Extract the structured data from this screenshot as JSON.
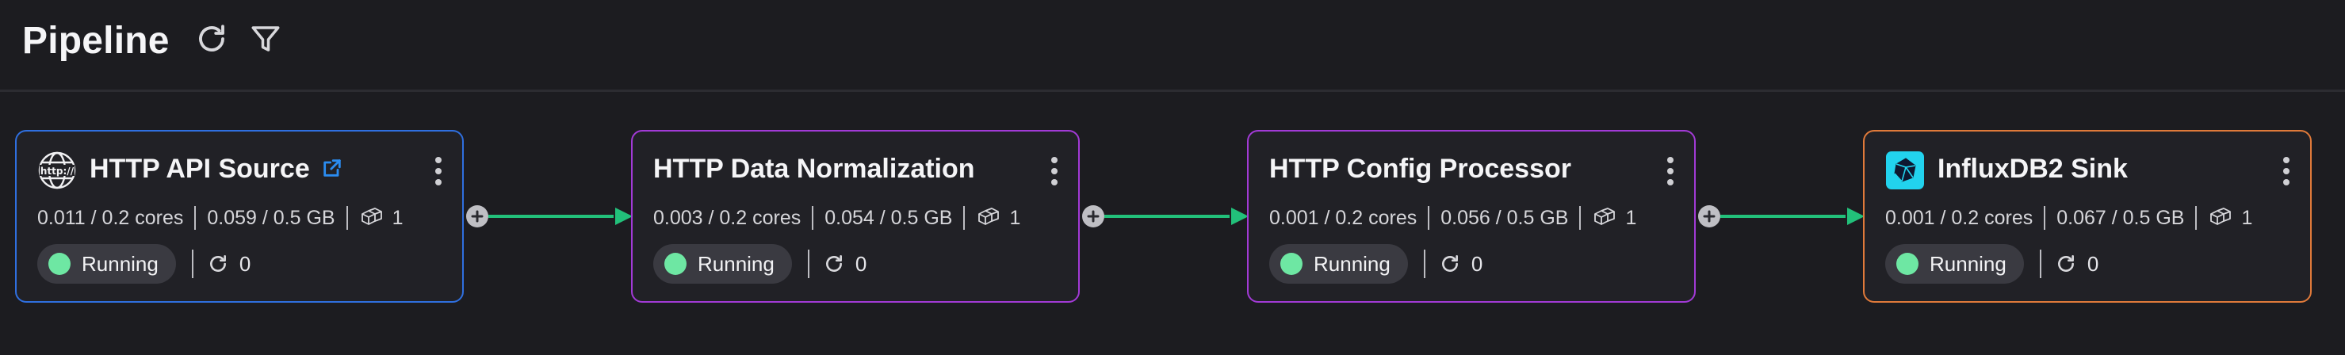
{
  "header": {
    "title": "Pipeline",
    "refresh_icon": "refresh-icon",
    "filter_icon": "filter-icon"
  },
  "colors": {
    "background": "#1c1c20",
    "card_background": "#212126",
    "source_border": "#2f6fdf",
    "processor_border": "#a23ad6",
    "sink_border": "#e07a3a",
    "edge": "#22c07a",
    "running_dot": "#6ee7a3",
    "link": "#2b8cf0"
  },
  "nodes": [
    {
      "title": "HTTP API Source",
      "kind": "source",
      "logo": "http-globe-icon",
      "has_external_link": true,
      "cpu": "0.011 / 0.2 cores",
      "memory": "0.059 / 0.5 GB",
      "replicas": "1",
      "status": "Running",
      "restarts": "0"
    },
    {
      "title": "HTTP Data Normalization",
      "kind": "processor",
      "logo": "",
      "has_external_link": false,
      "cpu": "0.003 / 0.2 cores",
      "memory": "0.054 / 0.5 GB",
      "replicas": "1",
      "status": "Running",
      "restarts": "0"
    },
    {
      "title": "HTTP Config Processor",
      "kind": "processor",
      "logo": "",
      "has_external_link": false,
      "cpu": "0.001 / 0.2 cores",
      "memory": "0.056 / 0.5 GB",
      "replicas": "1",
      "status": "Running",
      "restarts": "0"
    },
    {
      "title": "InfluxDB2 Sink",
      "kind": "sink",
      "logo": "influxdb-icon",
      "has_external_link": false,
      "cpu": "0.001 / 0.2 cores",
      "memory": "0.067 / 0.5 GB",
      "replicas": "1",
      "status": "Running",
      "restarts": "0"
    }
  ]
}
